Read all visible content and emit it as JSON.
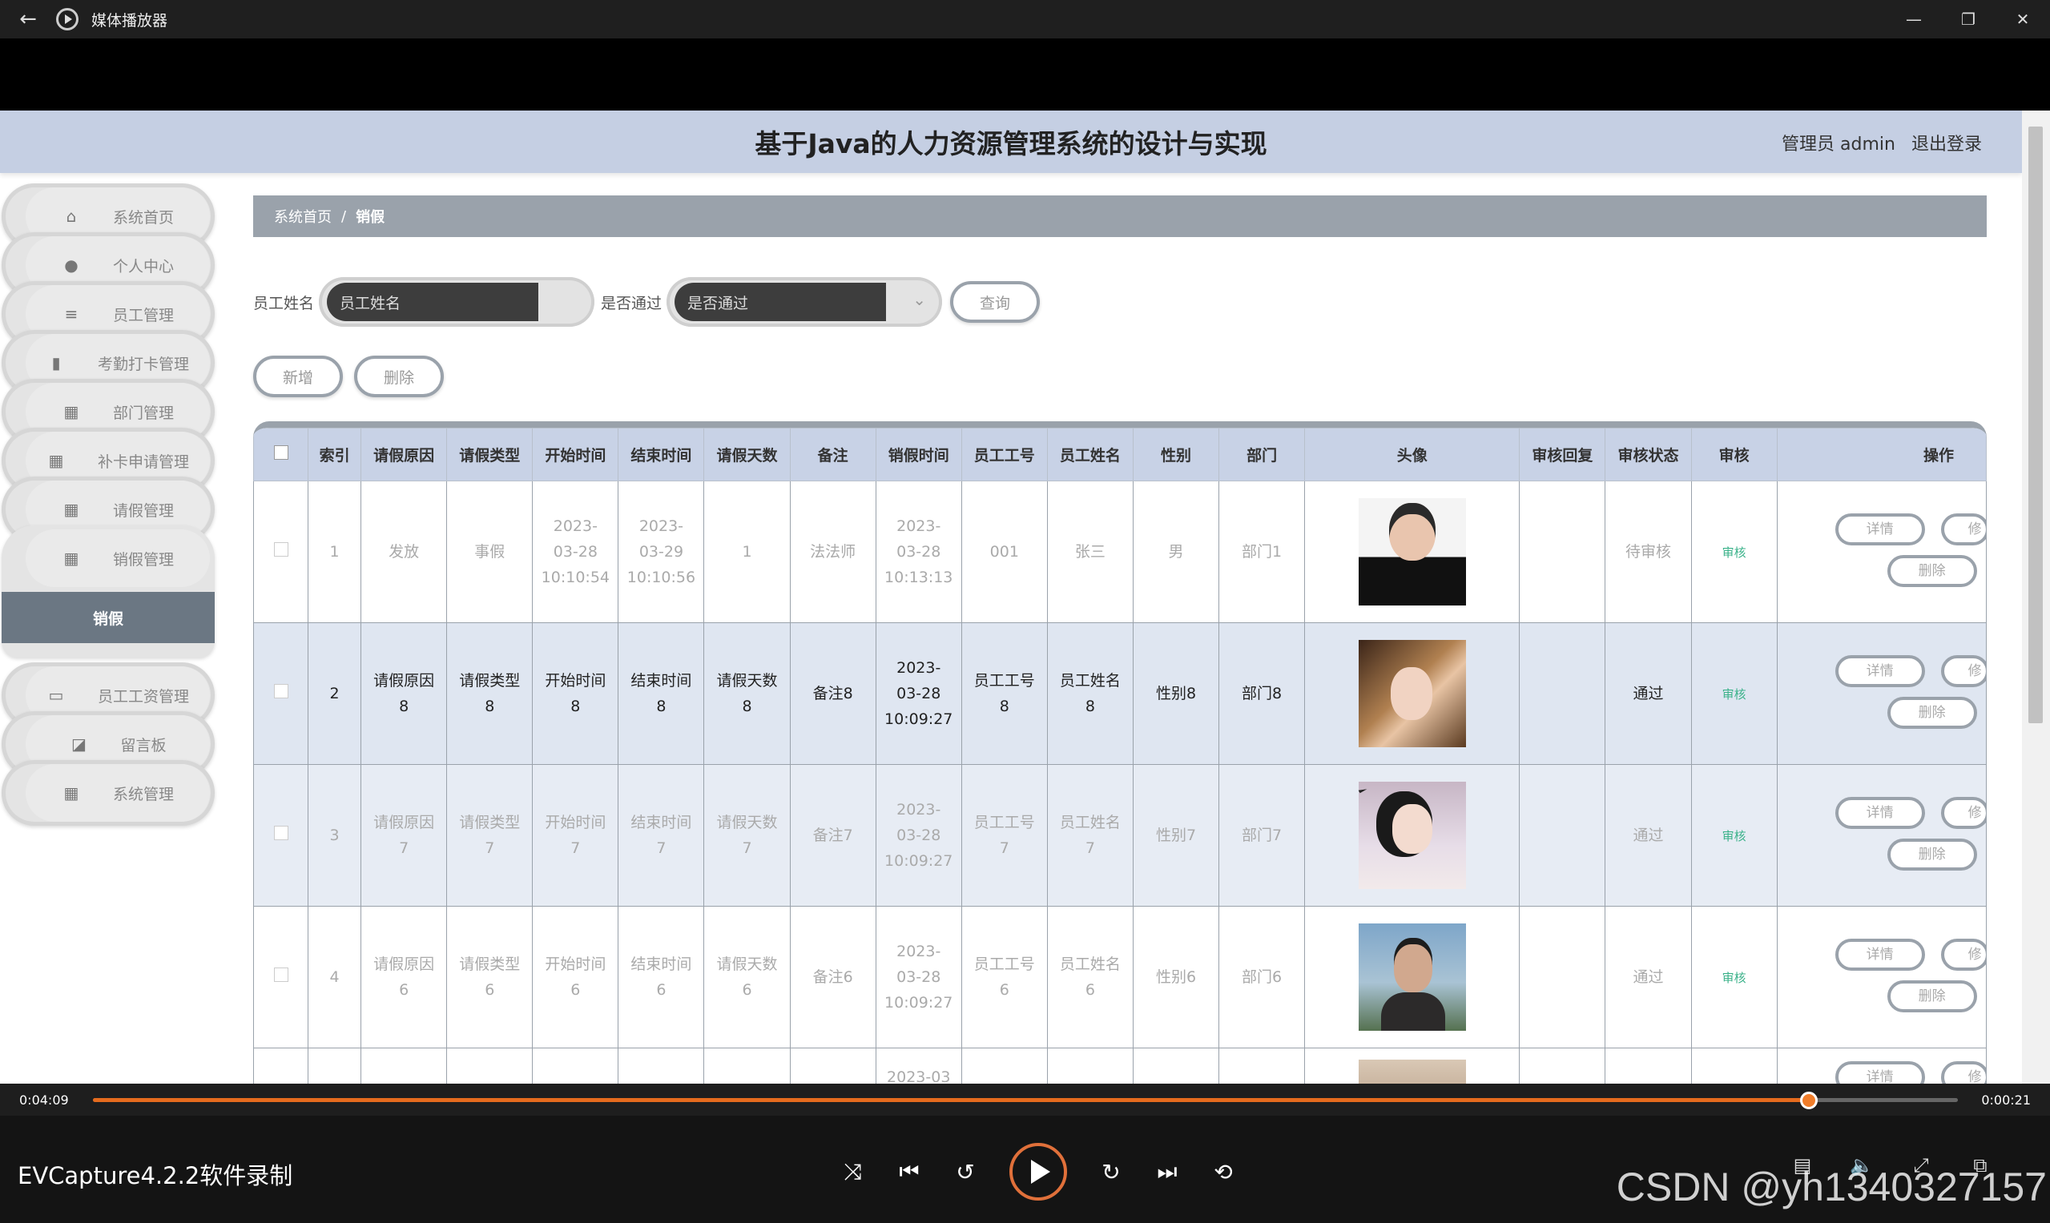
{
  "window": {
    "title": "媒体播放器"
  },
  "header": {
    "title": "基于Java的人力资源管理系统的设计与实现",
    "user_label": "管理员 admin",
    "logout": "退出登录"
  },
  "sidebar": {
    "items": [
      {
        "label": "系统首页",
        "icon": "home-icon"
      },
      {
        "label": "个人中心",
        "icon": "person-icon"
      },
      {
        "label": "员工管理",
        "icon": "sliders-icon"
      },
      {
        "label": "考勤打卡管理",
        "icon": "bar-chart-icon"
      },
      {
        "label": "部门管理",
        "icon": "grid-icon"
      },
      {
        "label": "补卡申请管理",
        "icon": "grid-icon"
      },
      {
        "label": "请假管理",
        "icon": "grid-icon"
      },
      {
        "label": "销假管理",
        "icon": "grid-icon",
        "sub": "销假"
      },
      {
        "label": "员工工资管理",
        "icon": "monitor-icon"
      },
      {
        "label": "留言板",
        "icon": "chart-icon"
      },
      {
        "label": "系统管理",
        "icon": "grid-icon"
      }
    ]
  },
  "breadcrumb": {
    "home": "系统首页",
    "sep": "/",
    "current": "销假"
  },
  "search": {
    "name_label": "员工姓名",
    "name_placeholder": "员工姓名",
    "pass_label": "是否通过",
    "pass_placeholder": "是否通过",
    "query_button": "查询"
  },
  "actions": {
    "add": "新增",
    "delete": "删除"
  },
  "table": {
    "headers": [
      "索引",
      "请假原因",
      "请假类型",
      "开始时间",
      "结束时间",
      "请假天数",
      "备注",
      "销假时间",
      "员工工号",
      "员工姓名",
      "性别",
      "部门",
      "头像",
      "审核回复",
      "审核状态",
      "审核",
      "操作"
    ],
    "rows": [
      [
        "1",
        "发放",
        "事假",
        "2023-03-28 10:10:54",
        "2023-03-29 10:10:56",
        "1",
        "法法师",
        "2023-03-28 10:13:13",
        "001",
        "张三",
        "男",
        "部门1",
        "",
        "",
        "待审核",
        "审核"
      ],
      [
        "2",
        "请假原因8",
        "请假类型8",
        "开始时间8",
        "结束时间8",
        "请假天数8",
        "备注8",
        "2023-03-28 10:09:27",
        "员工工号8",
        "员工姓名8",
        "性别8",
        "部门8",
        "",
        "",
        "通过",
        "审核"
      ],
      [
        "3",
        "请假原因7",
        "请假类型7",
        "开始时间7",
        "结束时间7",
        "请假天数7",
        "备注7",
        "2023-03-28 10:09:27",
        "员工工号7",
        "员工姓名7",
        "性别7",
        "部门7",
        "",
        "",
        "通过",
        "审核"
      ],
      [
        "4",
        "请假原因6",
        "请假类型6",
        "开始时间6",
        "结束时间6",
        "请假天数6",
        "备注6",
        "2023-03-28 10:09:27",
        "员工工号6",
        "员工姓名6",
        "性别6",
        "部门6",
        "",
        "",
        "通过",
        "审核"
      ],
      [
        "",
        "",
        "",
        "",
        "",
        "",
        "",
        "2023-03",
        "",
        "",
        "",
        "",
        "",
        "",
        "",
        ""
      ]
    ],
    "op_detail": "详情",
    "op_edit": "修",
    "op_delete": "删除"
  },
  "player": {
    "elapsed": "0:04:09",
    "remaining": "0:00:21",
    "progress_fraction": 0.92,
    "recorder_label": "EVCapture4.2.2软件录制",
    "watermark": "CSDN @yh1340327157"
  },
  "colors": {
    "header_bg": "#c5cfe3",
    "breadcrumb_bg": "#9aa2ab",
    "accent_orange": "#e56b1e",
    "status_green": "#3bb28a"
  }
}
